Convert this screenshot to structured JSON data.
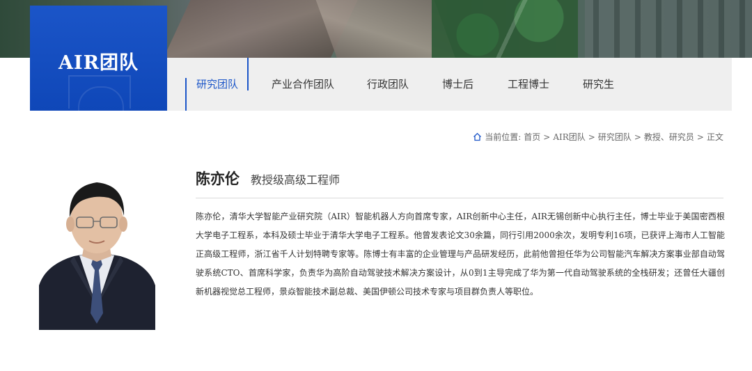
{
  "header": {
    "section_title": "AIR团队"
  },
  "nav": {
    "tabs": [
      {
        "label": "研究团队",
        "active": true
      },
      {
        "label": "产业合作团队",
        "active": false
      },
      {
        "label": "行政团队",
        "active": false
      },
      {
        "label": "博士后",
        "active": false
      },
      {
        "label": "工程博士",
        "active": false
      },
      {
        "label": "研究生",
        "active": false
      }
    ]
  },
  "breadcrumb": {
    "icon": "home-icon",
    "prefix": "当前位置:",
    "items": [
      "首页",
      "AIR团队",
      "研究团队",
      "教授、研究员",
      "正文"
    ],
    "separator": ">"
  },
  "profile": {
    "name": "陈亦伦",
    "title": "教授级高级工程师",
    "bio": "陈亦伦，清华大学智能产业研究院（AIR）智能机器人方向首席专家，AIR创新中心主任，AIR无锡创新中心执行主任，博士毕业于美国密西根大学电子工程系，本科及硕士毕业于清华大学电子工程系。他曾发表论文30余篇，同行引用2000余次，发明专利16项，已获评上海市人工智能正高级工程师，浙江省千人计划特聘专家等。陈博士有丰富的企业管理与产品研发经历，此前他曾担任华为公司智能汽车解决方案事业部自动驾驶系统CTO、首席科学家，负责华为高阶自动驾驶技术解决方案设计，从0到1主导完成了华为第一代自动驾驶系统的全栈研发；还曾任大疆创新机器视觉总工程师，景焱智能技术副总裁、美国伊顿公司技术专家与项目群负责人等职位。"
  },
  "colors": {
    "accent": "#1b55c8",
    "nav_bg": "#efefef"
  }
}
